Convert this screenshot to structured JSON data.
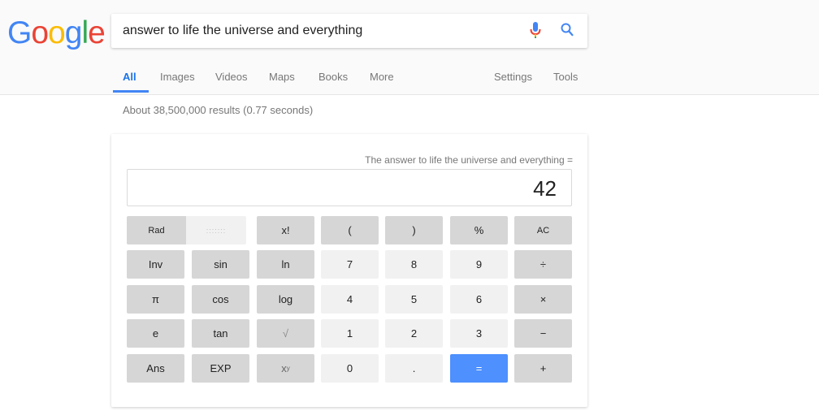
{
  "logo": {
    "letters": [
      "G",
      "o",
      "o",
      "g",
      "l",
      "e"
    ],
    "colors": [
      "#4285f4",
      "#ea4335",
      "#fbbc05",
      "#4285f4",
      "#34a853",
      "#ea4335"
    ]
  },
  "search": {
    "query": "answer to life the universe and everything",
    "mic_icon": "microphone-icon",
    "search_icon": "magnifier-icon"
  },
  "tabs": {
    "all": "All",
    "images": "Images",
    "videos": "Videos",
    "maps": "Maps",
    "books": "Books",
    "more": "More",
    "settings": "Settings",
    "tools": "Tools"
  },
  "stats": "About 38,500,000 results (0.77 seconds)",
  "calculator": {
    "expression": "The answer to life the universe and everything =",
    "result": "42",
    "keys": {
      "rad": "Rad",
      "deg": ":::::::",
      "fact": "x!",
      "lparen": "(",
      "rparen": ")",
      "percent": "%",
      "ac": "AC",
      "inv": "Inv",
      "sin": "sin",
      "ln": "ln",
      "seven": "7",
      "eight": "8",
      "nine": "9",
      "divide": "÷",
      "pi": "π",
      "cos": "cos",
      "log": "log",
      "four": "4",
      "five": "5",
      "six": "6",
      "multiply": "×",
      "e": "e",
      "tan": "tan",
      "sqrt": "√",
      "one": "1",
      "two": "2",
      "three": "3",
      "minus": "−",
      "ans": "Ans",
      "exp": "EXP",
      "pow_base": "x",
      "pow_exp": "y",
      "zero": "0",
      "dot": ".",
      "equals": "=",
      "plus": "+"
    }
  },
  "colors": {
    "accent_blue": "#4285f4",
    "equals_button": "#4d90fe",
    "dark_key": "#d6d6d6",
    "light_key": "#f1f1f1"
  }
}
